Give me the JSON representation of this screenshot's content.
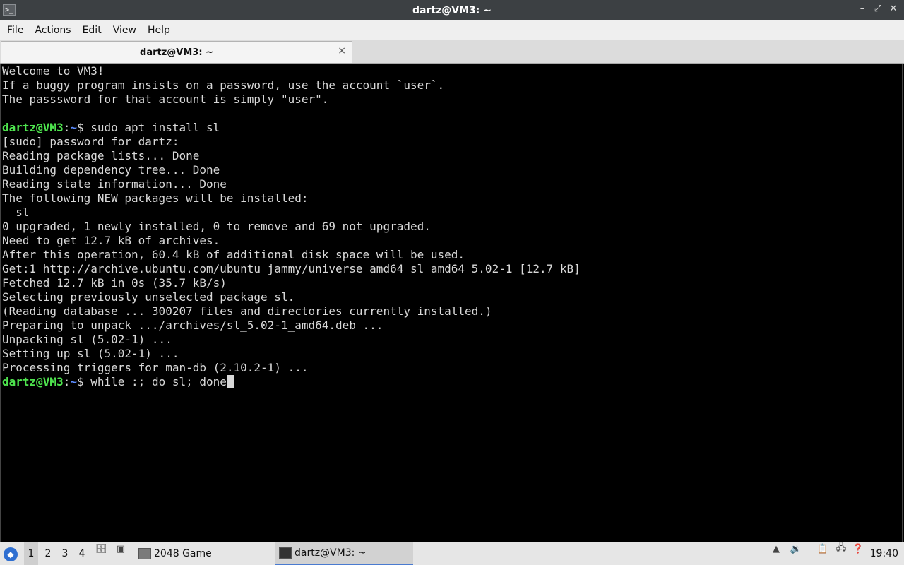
{
  "window": {
    "title": "dartz@VM3: ~",
    "app_icon": ">_",
    "controls": {
      "minimize": "–",
      "restore": "⤢",
      "close": "✕"
    }
  },
  "menu": [
    "File",
    "Actions",
    "Edit",
    "View",
    "Help"
  ],
  "tab": {
    "label": "dartz@VM3: ~",
    "close": "×"
  },
  "terminal": {
    "lines": [
      "Welcome to VM3!",
      "If a buggy program insists on a password, use the account `user`.",
      "The passsword for that account is simply \"user\".",
      "",
      "",
      "[sudo] password for dartz:",
      "Reading package lists... Done",
      "Building dependency tree... Done",
      "Reading state information... Done",
      "The following NEW packages will be installed:",
      "  sl",
      "0 upgraded, 1 newly installed, 0 to remove and 69 not upgraded.",
      "Need to get 12.7 kB of archives.",
      "After this operation, 60.4 kB of additional disk space will be used.",
      "Get:1 http://archive.ubuntu.com/ubuntu jammy/universe amd64 sl amd64 5.02-1 [12.7 kB]",
      "Fetched 12.7 kB in 0s (35.7 kB/s)",
      "Selecting previously unselected package sl.",
      "(Reading database ... 300207 files and directories currently installed.)",
      "Preparing to unpack .../archives/sl_5.02-1_amd64.deb ...",
      "Unpacking sl (5.02-1) ...",
      "Setting up sl (5.02-1) ...",
      "Processing triggers for man-db (2.10.2-1) ...",
      ""
    ],
    "prompt_user": "dartz@VM3",
    "prompt_sep": ":",
    "prompt_path": "~",
    "prompt_symbol": "$ ",
    "command_1": "sudo apt install sl",
    "command_2": "while :; do sl; done"
  },
  "taskbar": {
    "workspaces": [
      "1",
      "2",
      "3",
      "4"
    ],
    "active_workspace": "1",
    "tasks": [
      {
        "label": "2048 Game"
      },
      {
        "label": "dartz@VM3: ~"
      }
    ],
    "clock": "19:40"
  }
}
